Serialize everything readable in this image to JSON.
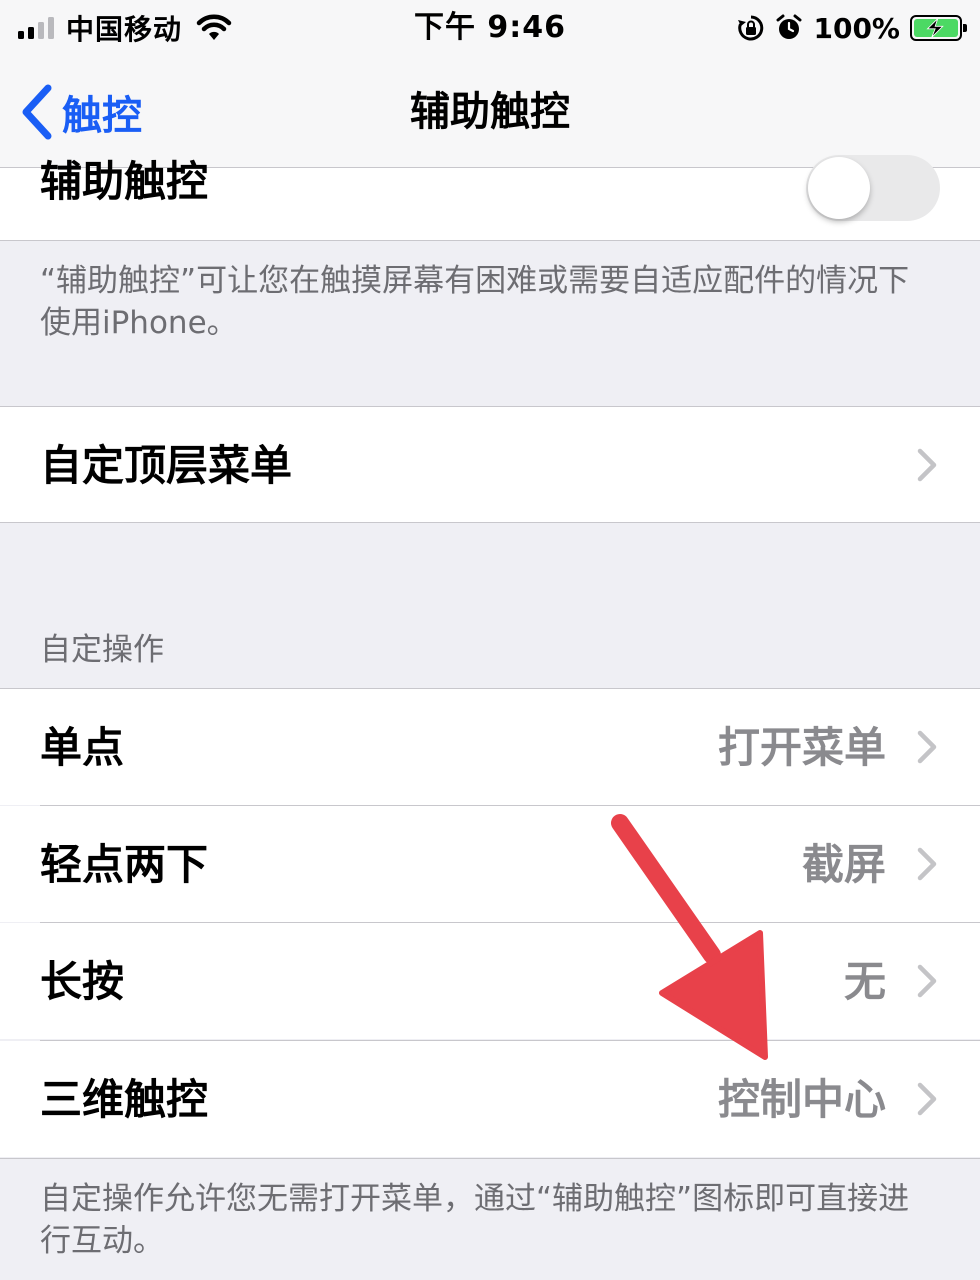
{
  "status_bar": {
    "carrier": "中国移动",
    "time": "下午 9:46",
    "battery_percent": "100%",
    "icons": [
      "signal-icon",
      "wifi-icon",
      "orientation-lock-icon",
      "alarm-icon",
      "battery-charging-icon"
    ]
  },
  "nav": {
    "back_label": "触控",
    "title": "辅助触控"
  },
  "assistive_touch": {
    "label": "辅助触控",
    "toggle_on": false
  },
  "description": "“辅助触控”可让您在触摸屏幕有困难或需要自适应配件的情况下使用iPhone。",
  "customize_menu": {
    "label": "自定顶层菜单"
  },
  "custom_actions": {
    "header": "自定操作",
    "items": [
      {
        "label": "单点",
        "value": "打开菜单"
      },
      {
        "label": "轻点两下",
        "value": "截屏"
      },
      {
        "label": "长按",
        "value": "无"
      },
      {
        "label": "三维触控",
        "value": "控制中心"
      }
    ],
    "footer": "自定操作允许您无需打开菜单，通过“辅助触控”图标即可直接进行互动。"
  },
  "colors": {
    "accent": "#1a5ef5",
    "background": "#efeff4",
    "annotation_arrow": "#e8414a"
  }
}
